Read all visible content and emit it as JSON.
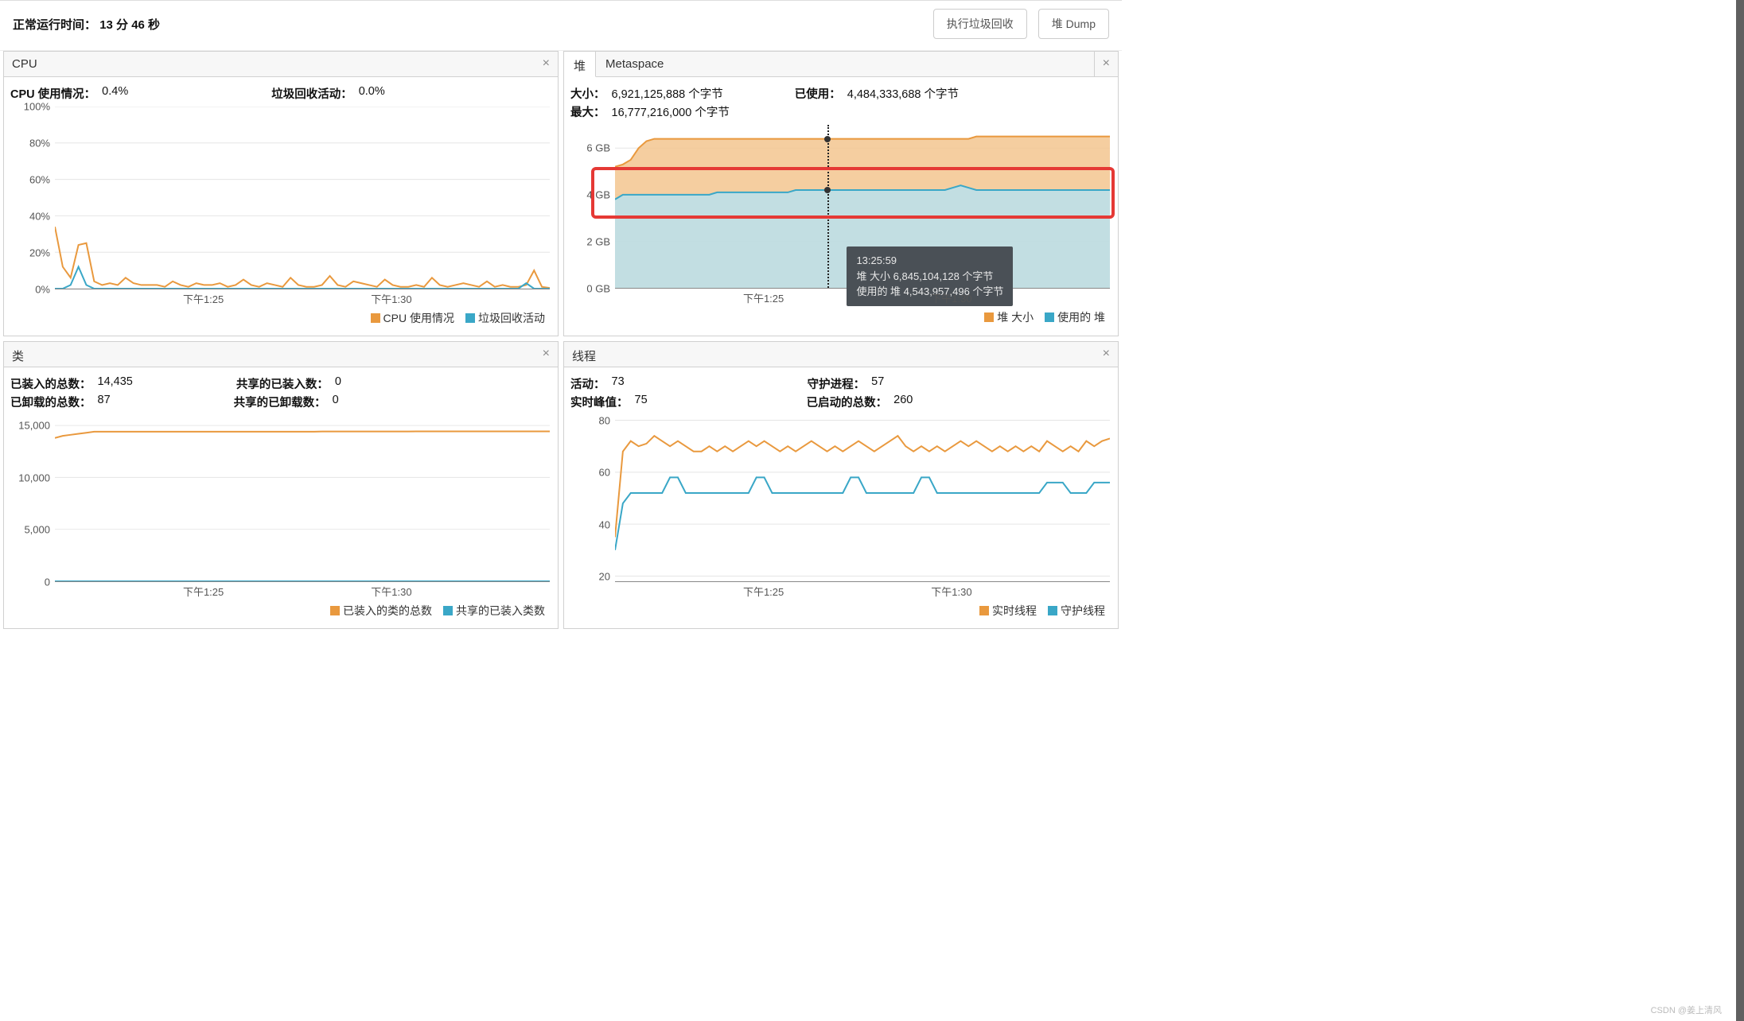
{
  "colors": {
    "orange": "#e9993e",
    "blue": "#3aa7c7",
    "orangeFill": "#f3c68f",
    "blueFill": "#b8e1ed"
  },
  "topbar": {
    "uptime_label": "正常运行时间",
    "uptime_value": "13 分 46 秒",
    "gc_button": "执行垃圾回收",
    "dump_button": "堆 Dump"
  },
  "panels": {
    "cpu": {
      "title": "CPU",
      "stats": [
        {
          "lbl": "CPU 使用情况",
          "val": "0.4%"
        },
        {
          "lbl": "垃圾回收活动",
          "val": "0.0%"
        }
      ],
      "legend": [
        {
          "color": "#e9993e",
          "label": "CPU 使用情况"
        },
        {
          "color": "#3aa7c7",
          "label": "垃圾回收活动"
        }
      ]
    },
    "heap": {
      "tabs": [
        {
          "label": "堆",
          "active": true
        },
        {
          "label": "Metaspace",
          "active": false
        }
      ],
      "stats_row1": [
        {
          "lbl": "大小",
          "val": "6,921,125,888 个字节"
        },
        {
          "lbl": "已使用",
          "val": "4,484,333,688 个字节"
        }
      ],
      "stats_row2": [
        {
          "lbl": "最大",
          "val": "16,777,216,000 个字节"
        }
      ],
      "tooltip": {
        "time": "13:25:59",
        "lines": [
          "堆 大小    6,845,104,128 个字节",
          "使用的 堆  4,543,957,496 个字节"
        ]
      },
      "legend": [
        {
          "color": "#e9993e",
          "label": "堆 大小"
        },
        {
          "color": "#3aa7c7",
          "label": "使用的 堆"
        }
      ]
    },
    "classes": {
      "title": "类",
      "stats_row1": [
        {
          "lbl": "已装入的总数",
          "val": "14,435"
        },
        {
          "lbl": "共享的已装入数",
          "val": "0"
        }
      ],
      "stats_row2": [
        {
          "lbl": "已卸载的总数",
          "val": "87"
        },
        {
          "lbl": "共享的已卸载数",
          "val": "0"
        }
      ],
      "legend": [
        {
          "color": "#e9993e",
          "label": "已装入的类的总数"
        },
        {
          "color": "#3aa7c7",
          "label": "共享的已装入类数"
        }
      ]
    },
    "threads": {
      "title": "线程",
      "stats_row1": [
        {
          "lbl": "活动",
          "val": "73"
        },
        {
          "lbl": "守护进程",
          "val": "57"
        }
      ],
      "stats_row2": [
        {
          "lbl": "实时峰值",
          "val": "75"
        },
        {
          "lbl": "已启动的总数",
          "val": "260"
        }
      ],
      "legend": [
        {
          "color": "#e9993e",
          "label": "实时线程"
        },
        {
          "color": "#3aa7c7",
          "label": "守护线程"
        }
      ]
    }
  },
  "chart_data": [
    {
      "id": "cpu",
      "type": "line",
      "xlabel": "",
      "ylabel": "%",
      "ylim": [
        0,
        100
      ],
      "y_ticks": [
        0,
        20,
        40,
        60,
        80,
        100
      ],
      "x_ticks": [
        "下午1:25",
        "下午1:30"
      ],
      "x": [
        0,
        1,
        2,
        3,
        4,
        5,
        6,
        7,
        8,
        9,
        10,
        11,
        12,
        13,
        14,
        15,
        16,
        17,
        18,
        19,
        20,
        21,
        22,
        23,
        24,
        25,
        26,
        27,
        28,
        29,
        30,
        31,
        32,
        33,
        34,
        35,
        36,
        37,
        38,
        39,
        40,
        41,
        42,
        43,
        44,
        45,
        46,
        47,
        48,
        49,
        50,
        51,
        52,
        53,
        54,
        55,
        56,
        57,
        58,
        59,
        60,
        61,
        62,
        63
      ],
      "series": [
        {
          "name": "CPU 使用情况",
          "color": "#e9993e",
          "values": [
            34,
            12,
            6,
            24,
            25,
            4,
            2,
            3,
            2,
            6,
            3,
            2,
            2,
            2,
            1,
            4,
            2,
            1,
            3,
            2,
            2,
            3,
            1,
            2,
            5,
            2,
            1,
            3,
            2,
            1,
            6,
            2,
            1,
            1,
            2,
            7,
            2,
            1,
            4,
            3,
            2,
            1,
            5,
            2,
            1,
            1,
            2,
            1,
            6,
            2,
            1,
            2,
            3,
            2,
            1,
            4,
            1,
            2,
            1,
            1,
            2,
            10,
            1,
            0.4
          ]
        },
        {
          "name": "垃圾回收活动",
          "color": "#3aa7c7",
          "values": [
            0,
            0,
            2,
            12,
            2,
            0,
            0,
            0,
            0,
            0,
            0,
            0,
            0,
            0,
            0,
            0,
            0,
            0,
            0,
            0,
            0,
            0,
            0,
            0,
            0,
            0,
            0,
            0,
            0,
            0,
            0,
            0,
            0,
            0,
            0,
            0,
            0,
            0,
            0,
            0,
            0,
            0,
            0,
            0,
            0,
            0,
            0,
            0,
            0,
            0,
            0,
            0,
            0,
            0,
            0,
            0,
            0,
            0,
            0,
            0,
            3,
            0,
            0,
            0
          ]
        }
      ]
    },
    {
      "id": "heap",
      "type": "area",
      "xlabel": "",
      "ylabel": "GB",
      "ylim": [
        0,
        7
      ],
      "y_ticks": [
        0,
        2,
        4,
        6
      ],
      "y_tick_labels": [
        "0 GB",
        "2 GB",
        "4 GB",
        "6 GB"
      ],
      "x_ticks": [
        "下午1:25",
        "下午1:30"
      ],
      "x": [
        0,
        1,
        2,
        3,
        4,
        5,
        6,
        7,
        8,
        9,
        10,
        11,
        12,
        13,
        14,
        15,
        16,
        17,
        18,
        19,
        20,
        21,
        22,
        23,
        24,
        25,
        26,
        27,
        28,
        29,
        30,
        31,
        32,
        33,
        34,
        35,
        36,
        37,
        38,
        39,
        40,
        41,
        42,
        43,
        44,
        45,
        46,
        47,
        48,
        49,
        50,
        51,
        52,
        53,
        54,
        55,
        56,
        57,
        58,
        59,
        60,
        61,
        62,
        63
      ],
      "series": [
        {
          "name": "堆 大小",
          "color": "#e9993e",
          "fill": "#f3c68f",
          "values": [
            5.2,
            5.3,
            5.5,
            6.0,
            6.3,
            6.4,
            6.4,
            6.4,
            6.4,
            6.4,
            6.4,
            6.4,
            6.4,
            6.4,
            6.4,
            6.4,
            6.4,
            6.4,
            6.4,
            6.4,
            6.4,
            6.4,
            6.4,
            6.4,
            6.4,
            6.4,
            6.4,
            6.4,
            6.4,
            6.4,
            6.4,
            6.4,
            6.4,
            6.4,
            6.4,
            6.4,
            6.4,
            6.4,
            6.4,
            6.4,
            6.4,
            6.4,
            6.4,
            6.4,
            6.4,
            6.4,
            6.5,
            6.5,
            6.5,
            6.5,
            6.5,
            6.5,
            6.5,
            6.5,
            6.5,
            6.5,
            6.5,
            6.5,
            6.5,
            6.5,
            6.5,
            6.5,
            6.5,
            6.5
          ]
        },
        {
          "name": "使用的 堆",
          "color": "#3aa7c7",
          "fill": "#b8e1ed",
          "values": [
            3.8,
            4.0,
            4.0,
            4.0,
            4.0,
            4.0,
            4.0,
            4.0,
            4.0,
            4.0,
            4.0,
            4.0,
            4.0,
            4.1,
            4.1,
            4.1,
            4.1,
            4.1,
            4.1,
            4.1,
            4.1,
            4.1,
            4.1,
            4.2,
            4.2,
            4.2,
            4.2,
            4.2,
            4.2,
            4.2,
            4.2,
            4.2,
            4.2,
            4.2,
            4.2,
            4.2,
            4.2,
            4.2,
            4.2,
            4.2,
            4.2,
            4.2,
            4.2,
            4.3,
            4.4,
            4.3,
            4.2,
            4.2,
            4.2,
            4.2,
            4.2,
            4.2,
            4.2,
            4.2,
            4.2,
            4.2,
            4.2,
            4.2,
            4.2,
            4.2,
            4.2,
            4.2,
            4.2,
            4.2
          ]
        }
      ],
      "marker_x_index": 27,
      "highlight_y_range": [
        3.0,
        5.2
      ]
    },
    {
      "id": "classes",
      "type": "line",
      "xlabel": "",
      "ylabel": "count",
      "ylim": [
        0,
        16000
      ],
      "y_ticks": [
        0,
        5000,
        10000,
        15000
      ],
      "y_tick_labels": [
        "0",
        "5,000",
        "10,000",
        "15,000"
      ],
      "x_ticks": [
        "下午1:25",
        "下午1:30"
      ],
      "x": [
        0,
        1,
        2,
        3,
        4,
        5,
        6,
        7,
        8,
        9,
        10,
        11,
        12,
        13,
        14,
        15,
        16,
        17,
        18,
        19,
        20,
        21,
        22,
        23,
        24,
        25,
        26,
        27,
        28,
        29,
        30,
        31,
        32,
        33,
        34,
        35,
        36,
        37,
        38,
        39,
        40,
        41,
        42,
        43,
        44,
        45,
        46,
        47,
        48,
        49,
        50,
        51,
        52,
        53,
        54,
        55,
        56,
        57,
        58,
        59,
        60,
        61,
        62,
        63
      ],
      "series": [
        {
          "name": "已装入的类的总数",
          "color": "#e9993e",
          "values": [
            13800,
            14000,
            14100,
            14200,
            14300,
            14400,
            14400,
            14400,
            14400,
            14400,
            14400,
            14400,
            14400,
            14400,
            14400,
            14400,
            14400,
            14400,
            14400,
            14400,
            14400,
            14400,
            14400,
            14400,
            14400,
            14400,
            14400,
            14400,
            14400,
            14400,
            14400,
            14400,
            14400,
            14400,
            14420,
            14420,
            14420,
            14420,
            14420,
            14420,
            14420,
            14420,
            14420,
            14420,
            14420,
            14420,
            14430,
            14430,
            14430,
            14430,
            14430,
            14430,
            14430,
            14430,
            14430,
            14430,
            14430,
            14430,
            14430,
            14430,
            14430,
            14430,
            14430,
            14435
          ]
        },
        {
          "name": "共享的已装入类数",
          "color": "#3aa7c7",
          "values": [
            0,
            0,
            0,
            0,
            0,
            0,
            0,
            0,
            0,
            0,
            0,
            0,
            0,
            0,
            0,
            0,
            0,
            0,
            0,
            0,
            0,
            0,
            0,
            0,
            0,
            0,
            0,
            0,
            0,
            0,
            0,
            0,
            0,
            0,
            0,
            0,
            0,
            0,
            0,
            0,
            0,
            0,
            0,
            0,
            0,
            0,
            0,
            0,
            0,
            0,
            0,
            0,
            0,
            0,
            0,
            0,
            0,
            0,
            0,
            0,
            0,
            0,
            0,
            0
          ]
        }
      ]
    },
    {
      "id": "threads",
      "type": "line",
      "xlabel": "",
      "ylabel": "count",
      "ylim": [
        18,
        82
      ],
      "y_ticks": [
        20,
        40,
        60,
        80
      ],
      "x_ticks": [
        "下午1:25",
        "下午1:30"
      ],
      "x": [
        0,
        1,
        2,
        3,
        4,
        5,
        6,
        7,
        8,
        9,
        10,
        11,
        12,
        13,
        14,
        15,
        16,
        17,
        18,
        19,
        20,
        21,
        22,
        23,
        24,
        25,
        26,
        27,
        28,
        29,
        30,
        31,
        32,
        33,
        34,
        35,
        36,
        37,
        38,
        39,
        40,
        41,
        42,
        43,
        44,
        45,
        46,
        47,
        48,
        49,
        50,
        51,
        52,
        53,
        54,
        55,
        56,
        57,
        58,
        59,
        60,
        61,
        62,
        63
      ],
      "series": [
        {
          "name": "实时线程",
          "color": "#e9993e",
          "values": [
            35,
            68,
            72,
            70,
            71,
            74,
            72,
            70,
            72,
            70,
            68,
            68,
            70,
            68,
            70,
            68,
            70,
            72,
            70,
            72,
            70,
            68,
            70,
            68,
            70,
            72,
            70,
            68,
            70,
            68,
            70,
            72,
            70,
            68,
            70,
            72,
            74,
            70,
            68,
            70,
            68,
            70,
            68,
            70,
            72,
            70,
            72,
            70,
            68,
            70,
            68,
            70,
            68,
            70,
            68,
            72,
            70,
            68,
            70,
            68,
            72,
            70,
            72,
            73
          ]
        },
        {
          "name": "守护线程",
          "color": "#3aa7c7",
          "values": [
            30,
            48,
            52,
            52,
            52,
            52,
            52,
            58,
            58,
            52,
            52,
            52,
            52,
            52,
            52,
            52,
            52,
            52,
            58,
            58,
            52,
            52,
            52,
            52,
            52,
            52,
            52,
            52,
            52,
            52,
            58,
            58,
            52,
            52,
            52,
            52,
            52,
            52,
            52,
            58,
            58,
            52,
            52,
            52,
            52,
            52,
            52,
            52,
            52,
            52,
            52,
            52,
            52,
            52,
            52,
            56,
            56,
            56,
            52,
            52,
            52,
            56,
            56,
            56
          ]
        }
      ]
    }
  ],
  "watermark": "CSDN @姜上清风"
}
